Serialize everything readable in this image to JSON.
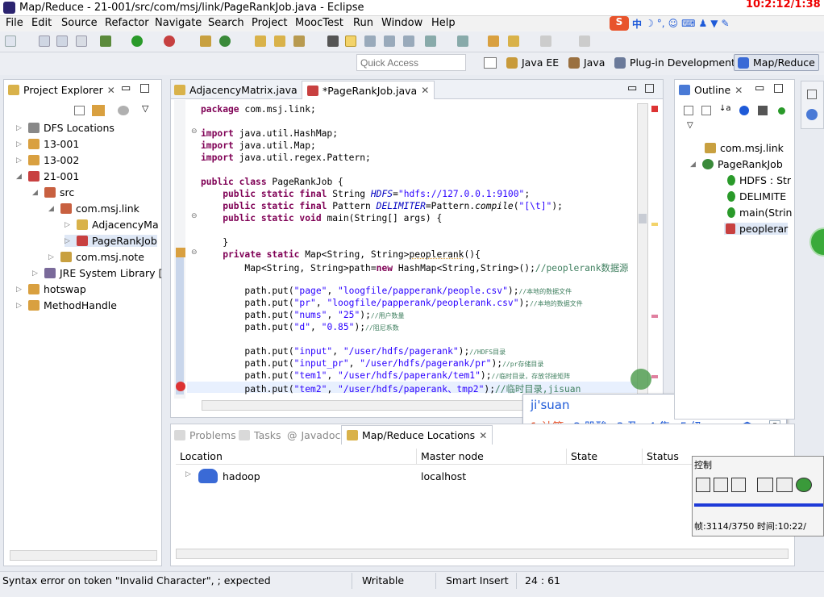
{
  "window": {
    "title": "Map/Reduce - 21-001/src/com/msj/link/PageRankJob.java - Eclipse",
    "clock": "10:2:12/1:38"
  },
  "menu": [
    "File",
    "Edit",
    "Source",
    "Refactor",
    "Navigate",
    "Search",
    "Project",
    "MoocTest",
    "Run",
    "Window",
    "Help"
  ],
  "quick_access": {
    "placeholder": "Quick Access"
  },
  "perspectives": [
    "Java EE",
    "Java",
    "Plug-in Development",
    "Map/Reduce"
  ],
  "explorer": {
    "title": "Project Explorer",
    "items": [
      "DFS Locations",
      "13-001",
      "13-002",
      "21-001",
      "src",
      "com.msj.link",
      "AdjacencyMa",
      "PageRankJob",
      "com.msj.note",
      "JRE System Library [",
      "hotswap",
      "MethodHandle"
    ]
  },
  "editor": {
    "tabs": [
      "AdjacencyMatrix.java",
      "*PageRankJob.java"
    ],
    "lines": [
      {
        "k": "package",
        "r": " com.msj.link;"
      },
      {
        "k": "",
        "r": ""
      },
      {
        "k": "import",
        "r": " java.util.HashMap;"
      },
      {
        "k": "import",
        "r": " java.util.Map;"
      },
      {
        "k": "import",
        "r": " java.util.regex.Pattern;"
      },
      {
        "k": "",
        "r": ""
      },
      {
        "k": "public class",
        "r": " PageRankJob {"
      }
    ],
    "l_hdfs": {
      "a": "    public static final",
      "b": " String ",
      "c": "HDFS",
      "d": "=",
      "e": "\"hdfs://127.0.0.1:9100\"",
      "f": ";"
    },
    "l_delim": {
      "a": "    public static final",
      "b": " Pattern ",
      "c": "DELIMITER",
      "d": "=Pattern.",
      "e": "compile",
      "f": "(",
      "g": "\"[\\t]\"",
      "h": ");"
    },
    "l_main": {
      "a": "    public static void",
      "b": " main(String[] args) {"
    },
    "l_close": "    }",
    "l_pr": {
      "a": "    private static",
      "b": " Map<String, String>",
      "c": "peoplerank",
      "d": "(){"
    },
    "l_map": {
      "a": "        Map<String, String>path=",
      "b": "new",
      "c": " HashMap<String,String>();",
      "d": "//peoplerank数据源"
    },
    "puts": [
      {
        "k": "\"page\"",
        "v": "\"loogfile/papperank/people.csv\"",
        "c": "//本地的数据文件"
      },
      {
        "k": "\"pr\"",
        "v": "\"loogfile/papperank/peoplerank.csv\"",
        "c": "//本地的数据文件"
      },
      {
        "k": "\"nums\"",
        "v": "\"25\"",
        "c": "//用户数量"
      },
      {
        "k": "\"d\"",
        "v": "\"0.85\"",
        "c": "//阻尼系数"
      }
    ],
    "puts2": [
      {
        "k": "\"input\"",
        "v": "\"/user/hdfs/pagerank\"",
        "c": "//HDFS目录"
      },
      {
        "k": "\"input_pr\"",
        "v": "\"/user/hdfs/pagerank/pr\"",
        "c": "//pr存储目录"
      },
      {
        "k": "\"tem1\"",
        "v": "\"/user/hdfs/paperank/tem1\"",
        "c": "//临时目录，存放邻接矩阵"
      },
      {
        "k": "\"tem2\"",
        "v": "\"/user/hdfs/paperank、tmp2\"",
        "c": "//临时目录,jisuan"
      }
    ]
  },
  "ime": {
    "input": "ji'suan",
    "candidates": [
      "1.计算",
      "2.肌酸",
      "3.及",
      "4.集",
      "5.级"
    ]
  },
  "outline": {
    "title": "Outline",
    "items": [
      "com.msj.link",
      "PageRankJob",
      "HDFS : Str",
      "DELIMITE",
      "main(Strin",
      "peoplerar"
    ]
  },
  "bottom": {
    "tabs": [
      "Problems",
      "Tasks",
      "Javadoc",
      "Map/Reduce Locations"
    ],
    "columns": [
      "Location",
      "Master node",
      "State",
      "Status"
    ],
    "row": {
      "location": "hadoop",
      "master": "localhost"
    }
  },
  "control": {
    "title": "控制",
    "frame": "帧:3114/3750 时间:10:22/"
  },
  "statusbar": {
    "message": "Syntax error on token \"Invalid Character\", ; expected",
    "mode": "Writable",
    "insert": "Smart Insert",
    "position": "24 : 61"
  },
  "colors": {
    "accent": "#e8542c",
    "keyword": "#7f0055",
    "string": "#2a00ff"
  }
}
